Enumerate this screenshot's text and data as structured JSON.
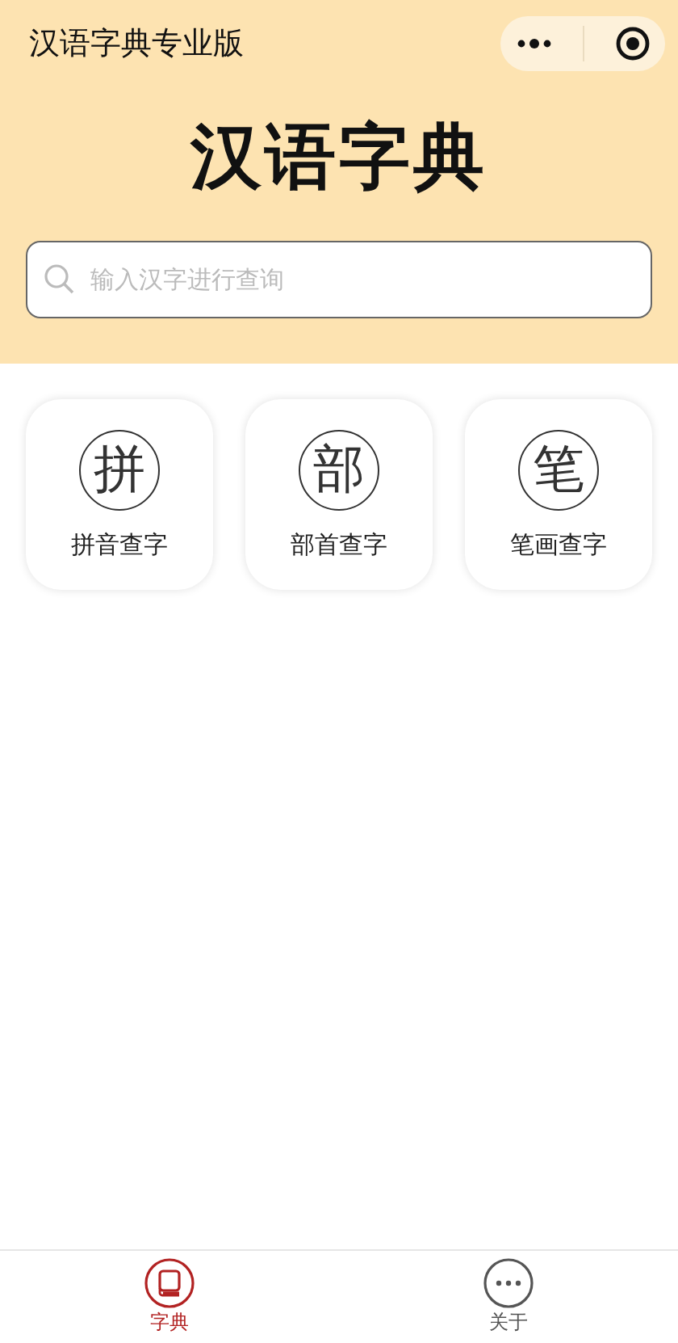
{
  "nav_bar": {
    "title": "汉语字典专业版"
  },
  "header": {
    "title": "汉语字典"
  },
  "search": {
    "placeholder": "输入汉字进行查询"
  },
  "methods": [
    {
      "glyph": "拼",
      "label": "拼音查字"
    },
    {
      "glyph": "部",
      "label": "部首查字"
    },
    {
      "glyph": "笔",
      "label": "笔画查字"
    }
  ],
  "tab_bar": [
    {
      "kind": "book",
      "label": "字典",
      "selected": true
    },
    {
      "kind": "more",
      "label": "关于",
      "selected": false
    }
  ]
}
